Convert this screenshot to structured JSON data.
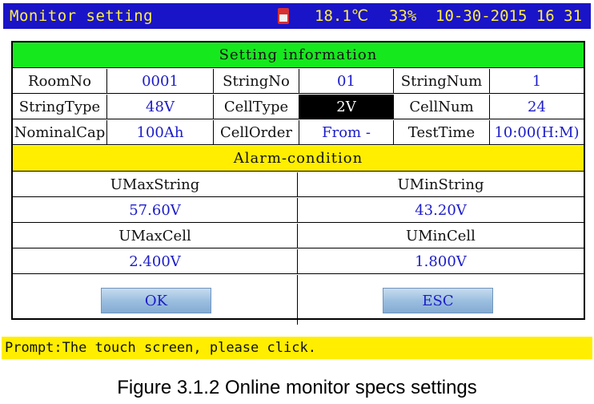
{
  "header": {
    "title": "Monitor setting",
    "icon": "sd-card-icon",
    "temperature": "18.1℃",
    "humidity": "33%",
    "datetime": "10-30-2015 16 31"
  },
  "setting_info": {
    "heading": "Setting information",
    "rows": [
      [
        {
          "text": "RoomNo",
          "kind": "label"
        },
        {
          "text": "0001",
          "kind": "value"
        },
        {
          "text": "StringNo",
          "kind": "label"
        },
        {
          "text": "01",
          "kind": "value"
        },
        {
          "text": "StringNum",
          "kind": "label"
        },
        {
          "text": "1",
          "kind": "value"
        }
      ],
      [
        {
          "text": "StringType",
          "kind": "label"
        },
        {
          "text": "48V",
          "kind": "value"
        },
        {
          "text": "CellType",
          "kind": "label"
        },
        {
          "text": "2V",
          "kind": "value",
          "selected": true
        },
        {
          "text": "CellNum",
          "kind": "label"
        },
        {
          "text": "24",
          "kind": "value"
        }
      ],
      [
        {
          "text": "NominalCap",
          "kind": "label"
        },
        {
          "text": "100Ah",
          "kind": "value"
        },
        {
          "text": "CellOrder",
          "kind": "label"
        },
        {
          "text": "From -",
          "kind": "value"
        },
        {
          "text": "TestTime",
          "kind": "label"
        },
        {
          "text": "10:00(H:M)",
          "kind": "value"
        }
      ]
    ]
  },
  "alarm": {
    "heading": "Alarm-condition",
    "umax_string_label": "UMaxString",
    "umin_string_label": "UMinString",
    "umax_string_value": "57.60V",
    "umin_string_value": "43.20V",
    "umax_cell_label": "UMaxCell",
    "umin_cell_label": "UMinCell",
    "umax_cell_value": "2.400V",
    "umin_cell_value": "1.800V"
  },
  "buttons": {
    "ok": "OK",
    "esc": "ESC"
  },
  "prompt": "Prompt:The touch screen, please click.",
  "caption": "Figure 3.1.2 Online monitor specs settings",
  "colors": {
    "titlebar": "#1a14c8",
    "title_text": "#ffee44",
    "setting_band": "#16e81e",
    "alarm_band": "#ffee00",
    "value_text": "#1c1cc8",
    "prompt_bar": "#ffee00"
  }
}
